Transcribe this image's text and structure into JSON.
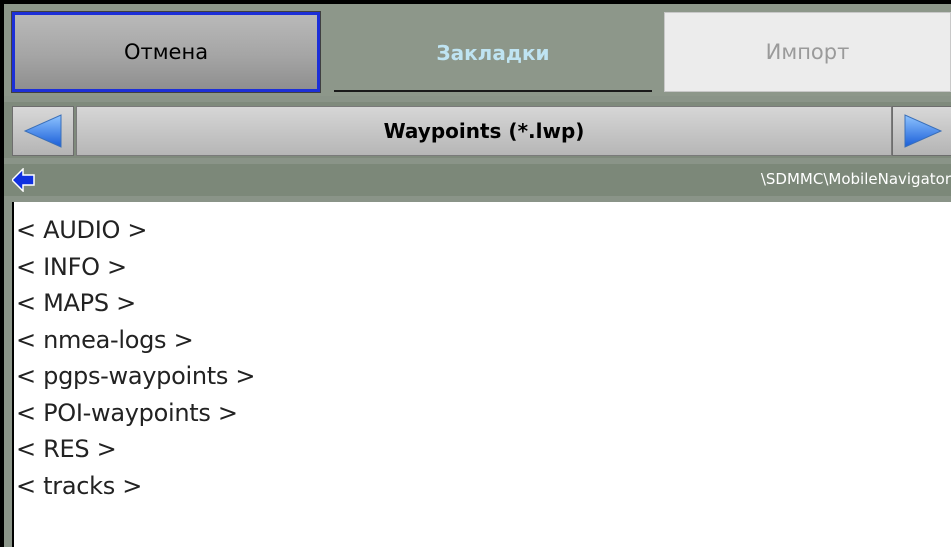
{
  "toolbar": {
    "cancel_label": "Отмена",
    "bookmarks_label": "Закладки",
    "import_label": "Импорт"
  },
  "selector": {
    "file_type": "Waypoints (*.lwp)",
    "left_icon": "triangle-left-icon",
    "right_icon": "triangle-right-icon"
  },
  "path": {
    "back_icon": "arrow-left-icon",
    "current": "\\SDMMC\\MobileNavigator"
  },
  "files": [
    "< AUDIO >",
    "< INFO >",
    "< MAPS >",
    "< nmea-logs >",
    "< pgps-waypoints >",
    "< POI-waypoints >",
    "< RES >",
    "< tracks >"
  ],
  "colors": {
    "accent_border": "#1c2fd8",
    "active_tab_text": "#bfe4f2",
    "arrow_blue": "#1a5ed8",
    "background": "#8a9488"
  }
}
